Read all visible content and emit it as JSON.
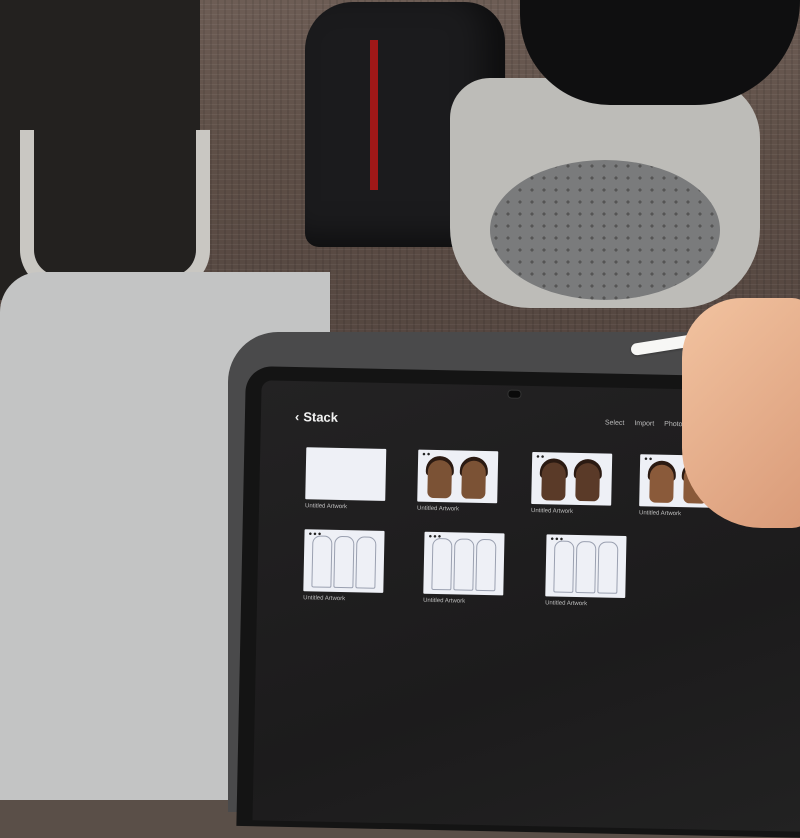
{
  "app": {
    "title": "Stack",
    "back_icon": "chevron-left-icon"
  },
  "header_actions": [
    "Select",
    "Import",
    "Photo"
  ],
  "artworks": [
    {
      "label": "Untitled Artwork",
      "sublabel": "",
      "kind": "blank"
    },
    {
      "label": "Untitled Artwork",
      "sublabel": "",
      "kind": "portrait-pair"
    },
    {
      "label": "Untitled Artwork",
      "sublabel": "",
      "kind": "portrait-pair"
    },
    {
      "label": "Untitled Artwork",
      "sublabel": "",
      "kind": "portrait-pair"
    },
    {
      "label": "Untitled Artwork",
      "sublabel": "",
      "kind": "sketch"
    },
    {
      "label": "Untitled Artwork",
      "sublabel": "",
      "kind": "sketch"
    },
    {
      "label": "Untitled Artwork",
      "sublabel": "",
      "kind": "sketch"
    }
  ],
  "colors": {
    "screen_bg": "#1f1e1f",
    "title_text": "#f2f2f2",
    "thumb_bg": "#eef0f6"
  }
}
